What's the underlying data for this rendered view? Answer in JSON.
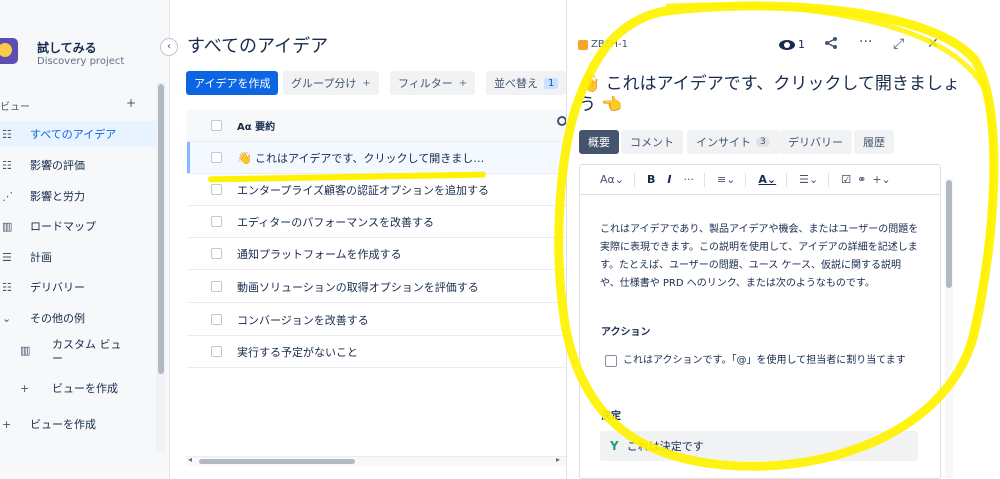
{
  "sidebar": {
    "project_name": "試してみる",
    "project_type": "Discovery project",
    "collapse_icon": "‹",
    "section_label": "ビュー",
    "section_add": "+",
    "items": [
      {
        "icon": "☷",
        "label": "すべてのアイデア"
      },
      {
        "icon": "☷",
        "label": "影響の評価"
      },
      {
        "icon": "⋰",
        "label": "影響と労力"
      },
      {
        "icon": "▥",
        "label": "ロードマップ"
      },
      {
        "icon": "☰",
        "label": "計画"
      },
      {
        "icon": "☷",
        "label": "デリバリー"
      },
      {
        "icon": "⌄",
        "label": "その他の例"
      },
      {
        "icon": "▥",
        "label": "カスタム ビュ\nー"
      },
      {
        "icon": "+",
        "label": "ビューを作成"
      },
      {
        "icon": "+",
        "label": "ビューを作成"
      }
    ]
  },
  "main": {
    "title": "すべてのアイデア",
    "toolbar": {
      "create": "アイデアを作成",
      "group": "グループ分け",
      "filter": "フィルター",
      "sort": "並べ替え",
      "sort_count": "1",
      "plus": "+"
    },
    "table": {
      "header": "Aα 要約",
      "rows": [
        {
          "emoji": "👋",
          "text": "これはアイデアです、クリックして開きまし…"
        },
        {
          "text": "エンタープライズ顧客の認証オプションを追加する"
        },
        {
          "text": "エディターのパフォーマンスを改善する"
        },
        {
          "text": "通知プラットフォームを作成する"
        },
        {
          "text": "動画ソリューションの取得オプションを評価する"
        },
        {
          "text": "コンバージョンを改善する"
        },
        {
          "text": "実行する予定がないこと"
        }
      ]
    },
    "scroll_left": "◂",
    "scroll_right": "▸"
  },
  "detail": {
    "issue_key": "ZBFH-1",
    "watchers": "1",
    "share_icon": "share-icon",
    "header_icons": [
      "<",
      "···",
      "⤢",
      "✕"
    ],
    "title_prefix": "👋",
    "title": "これはアイデアです、クリックして開きましょう",
    "title_suffix": "👈",
    "tabs": [
      "概要",
      "コメント",
      "インサイト",
      "デリバリー",
      "履歴"
    ],
    "insight_count": "3",
    "editor_toolbar": [
      "Aα⌄",
      "B",
      "I",
      "···",
      "≡⌄",
      "A⌄",
      "☰⌄",
      "☑",
      "⚭",
      "+⌄"
    ],
    "body": "これはアイデアであり、製品アイデアや機会、またはユーザーの問題を実際に表現できます。この説明を使用して、アイデアの詳細を記述します。たとえば、ユーザーの問題、ユース ケース、仮説に関する説明や、仕様書や PRD へのリンク、または次のようなものです。",
    "action_heading": "アクション",
    "action_text": "これはアクションです。「@」を使用して担当者に割り当てます",
    "decision_heading": "決定",
    "decision_icon": "Y",
    "decision_text": "これは決定です"
  },
  "colors": {
    "accent": "#0c66e4",
    "annotation": "#fff200"
  }
}
